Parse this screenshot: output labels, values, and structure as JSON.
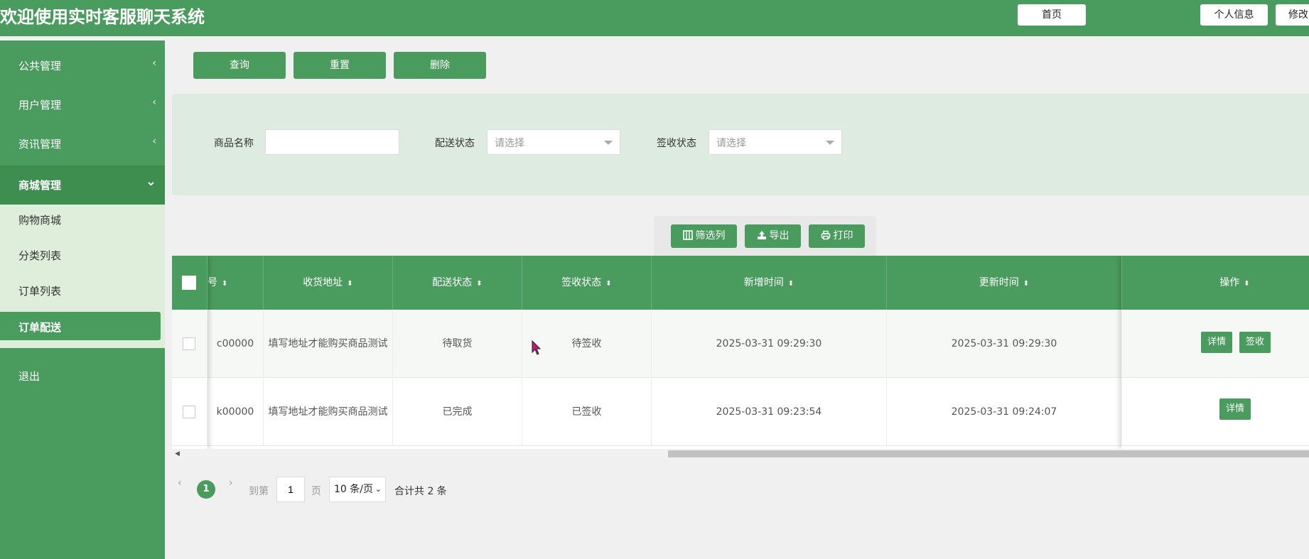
{
  "header": {
    "title": "欢迎使用实时客服聊天系统",
    "home": "首页",
    "profile": "个人信息",
    "change": "修改"
  },
  "sidebar": {
    "items": [
      {
        "label": "公共管理",
        "arrow": "‹"
      },
      {
        "label": "用户管理",
        "arrow": "‹"
      },
      {
        "label": "资讯管理",
        "arrow": "‹"
      },
      {
        "label": "商城管理",
        "arrow": "⌄"
      }
    ],
    "sub_items": [
      {
        "label": "购物商城"
      },
      {
        "label": "分类列表"
      },
      {
        "label": "订单列表"
      },
      {
        "label": "订单配送"
      }
    ],
    "logout": "退出"
  },
  "actions": {
    "query": "查询",
    "reset": "重置",
    "delete": "删除"
  },
  "filters": {
    "name_label": "商品名称",
    "name_value": "",
    "delivery_label": "配送状态",
    "delivery_placeholder": "请选择",
    "sign_label": "签收状态",
    "sign_placeholder": "请选择"
  },
  "toolbar": {
    "filter_cols": "筛选列",
    "export": "导出",
    "print": "打印"
  },
  "table": {
    "columns": [
      "号",
      "收货地址",
      "配送状态",
      "签收状态",
      "新增时间",
      "更新时间",
      "操作"
    ],
    "rows": [
      {
        "no": "c00000",
        "address": "填写地址才能购买商品测试",
        "delivery": "待取货",
        "sign": "待签收",
        "created": "2025-03-31 09:29:30",
        "updated": "2025-03-31 09:29:30",
        "actions": [
          "详情",
          "签收"
        ]
      },
      {
        "no": "k00000",
        "address": "填写地址才能购买商品测试",
        "delivery": "已完成",
        "sign": "已签收",
        "created": "2025-03-31 09:23:54",
        "updated": "2025-03-31 09:24:07",
        "actions": [
          "详情"
        ]
      }
    ]
  },
  "pagination": {
    "current": "1",
    "goto_label": "到第",
    "goto_value": "1",
    "page_unit": "页",
    "page_size": "10 条/页",
    "total": "合计共 2 条"
  },
  "colors": {
    "primary": "#4a9b5e",
    "panel": "#deebe0"
  }
}
